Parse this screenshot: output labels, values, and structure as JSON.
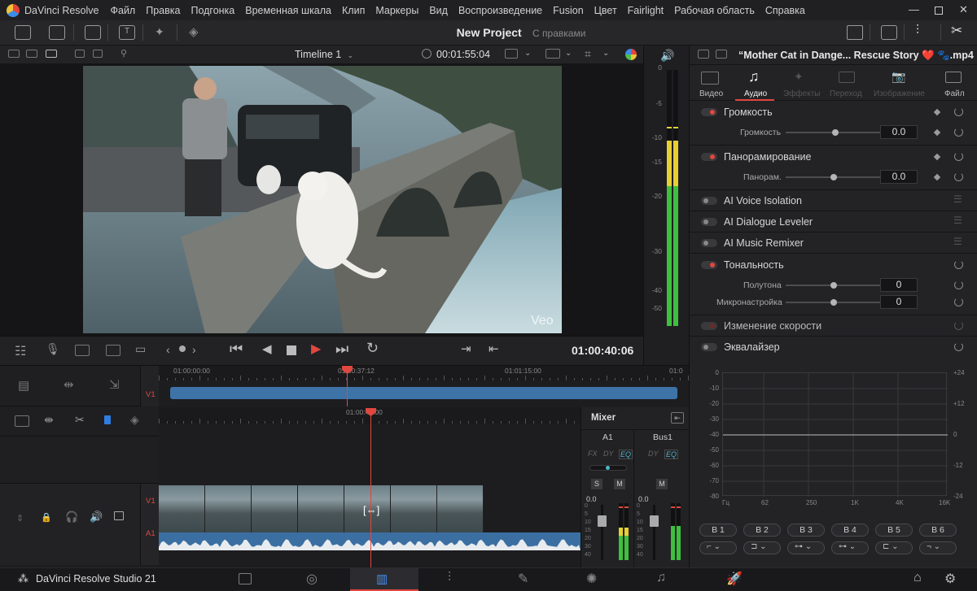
{
  "app": {
    "title": "DaVinci Resolve"
  },
  "menu": [
    "Файл",
    "Правка",
    "Подгонка",
    "Временная шкала",
    "Клип",
    "Маркеры",
    "Вид",
    "Воспроизведение",
    "Fusion",
    "Цвет",
    "Fairlight",
    "Рабочая область",
    "Справка"
  ],
  "project": {
    "name": "New Project",
    "status": "С правками"
  },
  "viewer": {
    "timeline_name": "Timeline 1",
    "source_timecode": "00:01:55:04",
    "current_timecode": "01:00:40:06",
    "watermark": "Veo"
  },
  "meter": {
    "scale": [
      "0",
      "-5",
      "-10",
      "-15",
      "-20",
      "-30",
      "-40",
      "-50"
    ],
    "left_level": 0.75,
    "right_level": 0.75
  },
  "inspector": {
    "clip_name": "“Mother Cat in Dange... Rescue Story ❤️ 🐾.mp4",
    "tabs": [
      "Видео",
      "Аудио",
      "Эффекты",
      "Переход",
      "Изображение",
      "Файл"
    ],
    "active_tab": "Аудио",
    "volume": {
      "title": "Громкость",
      "param": "Громкость",
      "value": "0.0",
      "level": 0.52
    },
    "pan": {
      "title": "Панорамирование",
      "param": "Панорам.",
      "value": "0.0",
      "level": 0.5
    },
    "ai_voice": "AI Voice Isolation",
    "ai_dialogue": "AI Dialogue Leveler",
    "ai_music": "AI Music Remixer",
    "pitch": {
      "title": "Тональность",
      "semitones_label": "Полутона",
      "semitones_value": "0",
      "cents_label": "Микронастройка",
      "cents_value": "0"
    },
    "speed": "Изменение скорости",
    "eq": {
      "title": "Эквалайзер",
      "left_scale": [
        "0",
        "-10",
        "-20",
        "-30",
        "-40",
        "-50",
        "-60",
        "-70",
        "-80"
      ],
      "right_scale": [
        "+24",
        "+12",
        "0",
        "-12",
        "-24"
      ],
      "freq_labels": [
        "Гц",
        "62",
        "250",
        "1K",
        "4K",
        "16K"
      ],
      "bands": [
        "B 1",
        "B 2",
        "B 3",
        "B 4",
        "B 5",
        "B 6"
      ]
    }
  },
  "timeline": {
    "ruler_top": [
      "01:00:00:00",
      "01:00:37:12",
      "01:01:15:00",
      "01:0"
    ],
    "ruler_bottom_mark": "01:00:40:00",
    "track_v1": "V1",
    "track_a1": "A1"
  },
  "mixer": {
    "title": "Mixer",
    "channels": [
      "A1",
      "Bus1"
    ],
    "a1_fx": [
      "FX",
      "DY",
      "EQ"
    ],
    "bus_fx": [
      "DY",
      "EQ"
    ],
    "solo": "S",
    "mute": "M",
    "level": "0.0",
    "fader_scale": [
      "0",
      "5",
      "10",
      "15",
      "20",
      "30",
      "40"
    ]
  },
  "bottom": {
    "product": "DaVinci Resolve Studio 21",
    "active_page": "edit"
  }
}
